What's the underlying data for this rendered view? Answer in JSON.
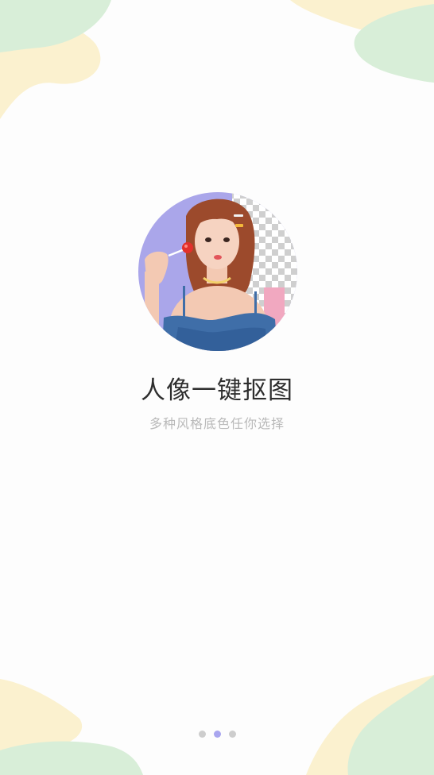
{
  "onboarding": {
    "title": "人像一键抠图",
    "subtitle": "多种风格底色任你选择"
  },
  "illustration": {
    "name": "portrait-cutout-illustration",
    "background_color": "#aaa6ea"
  },
  "pager": {
    "total_pages": 3,
    "active_index": 1,
    "active_color": "#a9a6ef",
    "inactive_color": "#cdcdcd"
  },
  "decor": {
    "green": "#d8eed8",
    "yellow": "#fbf1cf"
  }
}
